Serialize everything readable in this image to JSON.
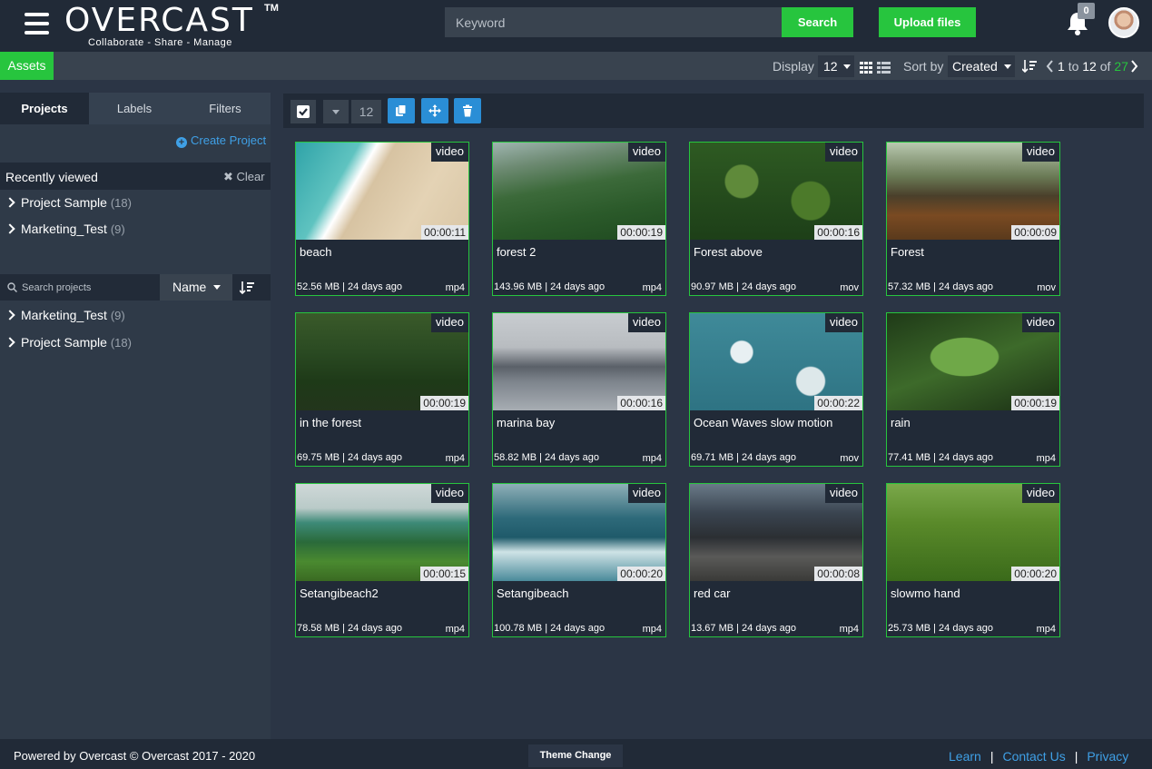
{
  "header": {
    "logo_text": "OVERCAST",
    "logo_tm": "TM",
    "logo_tagline": "Collaborate - Share - Manage",
    "search_placeholder": "Keyword",
    "search_label": "Search",
    "upload_label": "Upload files",
    "notification_count": "0"
  },
  "subbar": {
    "assets_label": "Assets",
    "display_label": "Display",
    "display_value": "12",
    "sortby_label": "Sort by",
    "sort_value": "Created",
    "pager_from": "1",
    "pager_to_word": "to",
    "pager_to": "12",
    "pager_of_word": "of",
    "pager_total": "27"
  },
  "sidebar": {
    "tabs": [
      {
        "label": "Projects"
      },
      {
        "label": "Labels"
      },
      {
        "label": "Filters"
      }
    ],
    "create_project_label": "Create Project",
    "recently_viewed_title": "Recently viewed",
    "clear_label": "Clear",
    "recent_items": [
      {
        "name": "Project Sample",
        "count": "(18)"
      },
      {
        "name": "Marketing_Test",
        "count": "(9)"
      }
    ],
    "search_placeholder": "Search projects",
    "sort_field": "Name",
    "project_items": [
      {
        "name": "Marketing_Test",
        "count": "(9)"
      },
      {
        "name": "Project Sample",
        "count": "(18)"
      }
    ]
  },
  "toolbar": {
    "selected_count": "12"
  },
  "assets": [
    {
      "title": "beach",
      "type": "video",
      "duration": "00:00:11",
      "meta": "52.56 MB | 24 days ago",
      "ext": "mp4",
      "theme": "beach"
    },
    {
      "title": "forest 2",
      "type": "video",
      "duration": "00:00:19",
      "meta": "143.96 MB | 24 days ago",
      "ext": "mp4",
      "theme": "hills"
    },
    {
      "title": "Forest above",
      "type": "video",
      "duration": "00:00:16",
      "meta": "90.97 MB | 24 days ago",
      "ext": "mov",
      "theme": "canopy"
    },
    {
      "title": "Forest",
      "type": "video",
      "duration": "00:00:09",
      "meta": "57.32 MB | 24 days ago",
      "ext": "mov",
      "theme": "pines"
    },
    {
      "title": "in the forest",
      "type": "video",
      "duration": "00:00:19",
      "meta": "69.75 MB | 24 days ago",
      "ext": "mp4",
      "theme": "jungle"
    },
    {
      "title": "marina bay",
      "type": "video",
      "duration": "00:00:16",
      "meta": "58.82 MB | 24 days ago",
      "ext": "mp4",
      "theme": "city"
    },
    {
      "title": "Ocean Waves slow motion",
      "type": "video",
      "duration": "00:00:22",
      "meta": "69.71 MB | 24 days ago",
      "ext": "mov",
      "theme": "waves"
    },
    {
      "title": "rain",
      "type": "video",
      "duration": "00:00:19",
      "meta": "77.41 MB | 24 days ago",
      "ext": "mp4",
      "theme": "leaves"
    },
    {
      "title": "Setangibeach2",
      "type": "video",
      "duration": "00:00:15",
      "meta": "78.58 MB | 24 days ago",
      "ext": "mp4",
      "theme": "palms"
    },
    {
      "title": "Setangibeach",
      "type": "video",
      "duration": "00:00:20",
      "meta": "100.78 MB | 24 days ago",
      "ext": "mp4",
      "theme": "sea"
    },
    {
      "title": "red car",
      "type": "video",
      "duration": "00:00:08",
      "meta": "13.67 MB | 24 days ago",
      "ext": "mp4",
      "theme": "road"
    },
    {
      "title": "slowmo hand",
      "type": "video",
      "duration": "00:00:20",
      "meta": "25.73 MB | 24 days ago",
      "ext": "mp4",
      "theme": "grass"
    }
  ],
  "footer": {
    "powered": "Powered by Overcast  ©  Overcast  2017 - 2020",
    "theme_label": "Theme Change",
    "links": [
      {
        "label": "Learn"
      },
      {
        "label": "Contact Us"
      },
      {
        "label": "Privacy"
      }
    ],
    "separator": "|"
  },
  "colors": {
    "accent_green": "#27c53e",
    "link_blue": "#3fa0e6",
    "header_bg": "#212a37",
    "body_bg": "#2b3545"
  }
}
